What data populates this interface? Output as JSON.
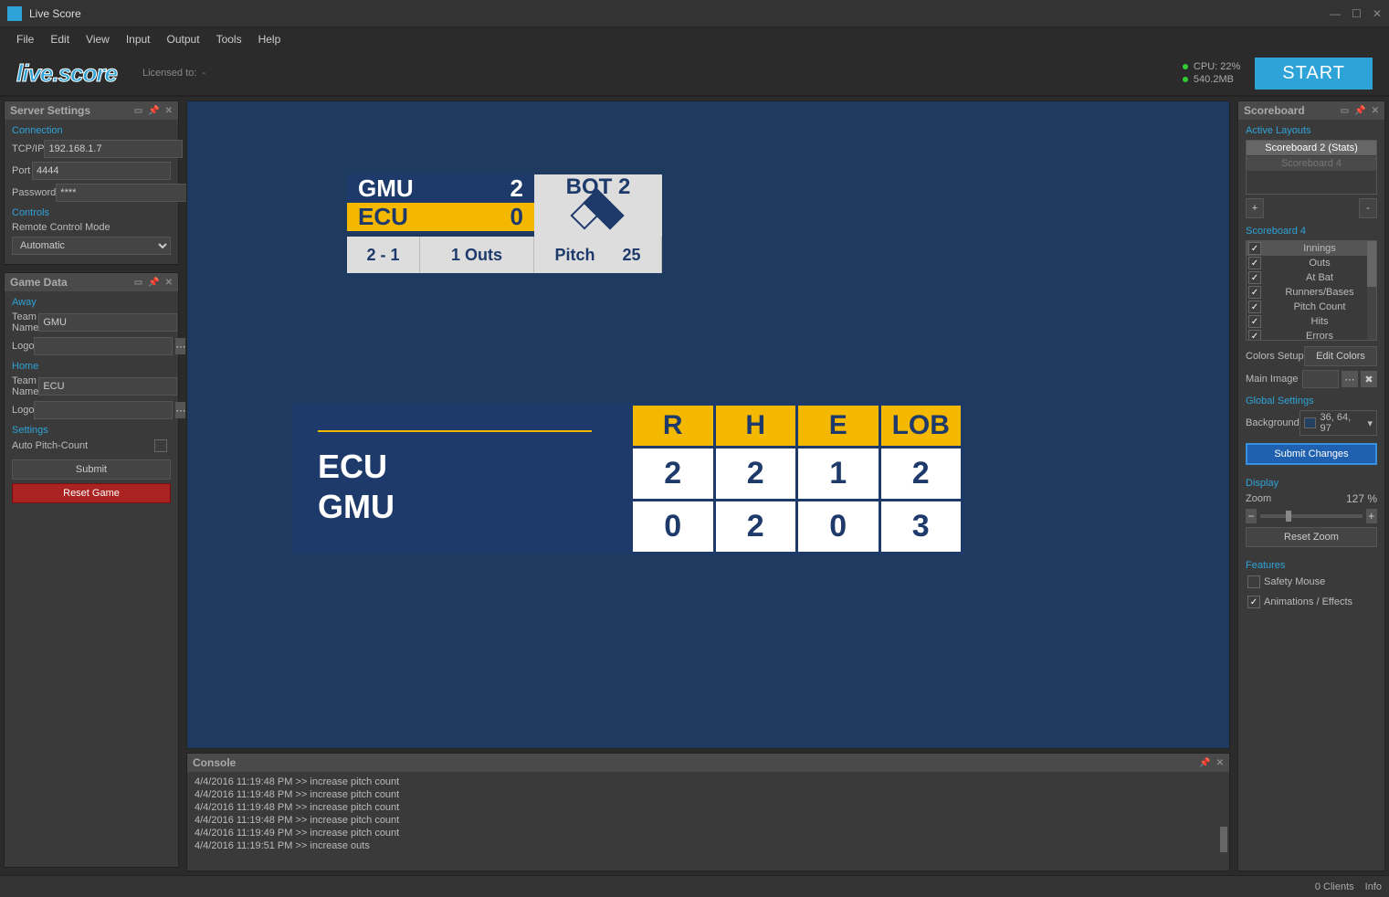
{
  "window": {
    "title": "Live Score"
  },
  "menus": [
    "File",
    "Edit",
    "View",
    "Input",
    "Output",
    "Tools",
    "Help"
  ],
  "header": {
    "logo": "live.score",
    "licensed_label": "Licensed to:",
    "licensed_value": "-",
    "cpu": "CPU: 22%",
    "mem": "540.2MB",
    "start": "START"
  },
  "server": {
    "title": "Server Settings",
    "connection_label": "Connection",
    "tcpip_label": "TCP/IP",
    "tcpip": "192.168.1.7",
    "port_label": "Port",
    "port": "4444",
    "password_label": "Password",
    "password": "****",
    "controls_label": "Controls",
    "remote_label": "Remote Control Mode",
    "remote_mode": "Automatic"
  },
  "gamedata": {
    "title": "Game Data",
    "away_label": "Away",
    "home_label": "Home",
    "teamname_label": "Team Name",
    "logo_label": "Logo",
    "away_team": "GMU",
    "home_team": "ECU",
    "settings_label": "Settings",
    "auto_pitch_label": "Auto Pitch-Count",
    "submit": "Submit",
    "reset": "Reset Game"
  },
  "sb1": {
    "away": "GMU",
    "away_score": "2",
    "home": "ECU",
    "home_score": "0",
    "inning": "BOT 2",
    "count": "2 - 1",
    "outs": "1 Outs",
    "pitch_label": "Pitch",
    "pitch": "25"
  },
  "sb2": {
    "team1": "ECU",
    "team2": "GMU",
    "headers": [
      "R",
      "H",
      "E",
      "LOB"
    ],
    "row1": [
      "2",
      "2",
      "1",
      "2"
    ],
    "row2": [
      "0",
      "2",
      "0",
      "3"
    ]
  },
  "console": {
    "title": "Console",
    "lines": [
      "4/4/2016 11:19:48 PM >> increase pitch count",
      "4/4/2016 11:19:48 PM >> increase pitch count",
      "4/4/2016 11:19:48 PM >> increase pitch count",
      "4/4/2016 11:19:48 PM >> increase pitch count",
      "4/4/2016 11:19:49 PM >> increase pitch count",
      "4/4/2016 11:19:51 PM >> increase outs"
    ]
  },
  "scoreboard_panel": {
    "title": "Scoreboard",
    "active_layouts_label": "Active Layouts",
    "layouts": [
      "Scoreboard 2 (Stats)",
      "Scoreboard 4"
    ],
    "sb4_label": "Scoreboard 4",
    "options": [
      "Innings",
      "Outs",
      "At Bat",
      "Runners/Bases",
      "Pitch Count",
      "Hits",
      "Errors"
    ],
    "colors_setup_label": "Colors Setup",
    "edit_colors": "Edit Colors",
    "main_image_label": "Main Image",
    "global_label": "Global Settings",
    "background_label": "Background",
    "background_value": "36, 64, 97",
    "submit_changes": "Submit Changes",
    "display_label": "Display",
    "zoom_label": "Zoom",
    "zoom_value": "127 %",
    "reset_zoom": "Reset Zoom",
    "features_label": "Features",
    "safety_mouse": "Safety Mouse",
    "animations": "Animations / Effects"
  },
  "status": {
    "clients": "0 Clients",
    "info": "Info"
  }
}
